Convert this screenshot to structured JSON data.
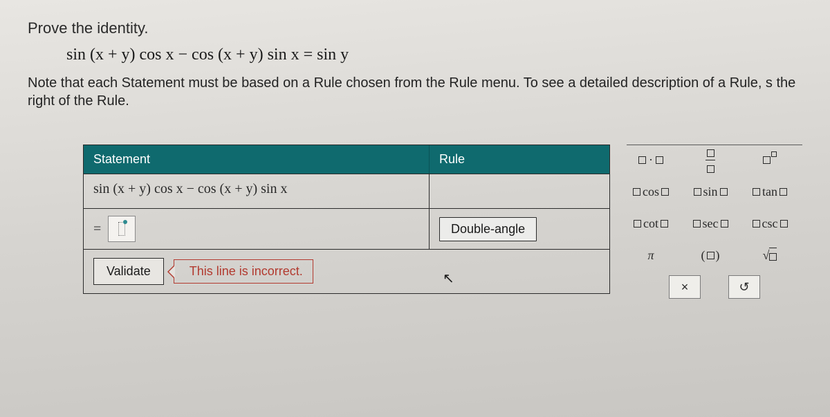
{
  "heading": "Prove the identity.",
  "identity": "sin (x + y) cos x − cos (x + y) sin x = sin y",
  "note": "Note that each Statement must be based on a Rule chosen from the Rule menu. To see a detailed description of a Rule, s the right of the Rule.",
  "table": {
    "header_statement": "Statement",
    "header_rule": "Rule",
    "row1_statement": "sin (x + y) cos x − cos (x + y) sin x",
    "row2_rule": "Double-angle",
    "eq": "="
  },
  "validate": {
    "button": "Validate",
    "error": "This line is incorrect."
  },
  "palette": {
    "r1": {
      "a": "▫ · ▫",
      "b_top": "▫",
      "b_bot": "▫",
      "c_base": "▫",
      "c_sup": "▫"
    },
    "r2": {
      "a_pre": "▫",
      "a_fn": "cos",
      "a_arg": "▫",
      "b_pre": "▫",
      "b_fn": "sin",
      "b_arg": "▫",
      "c_pre": "▫",
      "c_fn": "tan",
      "c_arg": "▫"
    },
    "r3": {
      "a_pre": "▫",
      "a_fn": "cot",
      "a_arg": "▫",
      "b_pre": "▫",
      "b_fn": "sec",
      "b_arg": "▫",
      "c_pre": "▫",
      "c_fn": "csc",
      "c_arg": "▫"
    },
    "r4": {
      "a": "π",
      "b": "(▫)",
      "c": "√▫"
    },
    "btn_clear": "×",
    "btn_reset": "↺"
  }
}
